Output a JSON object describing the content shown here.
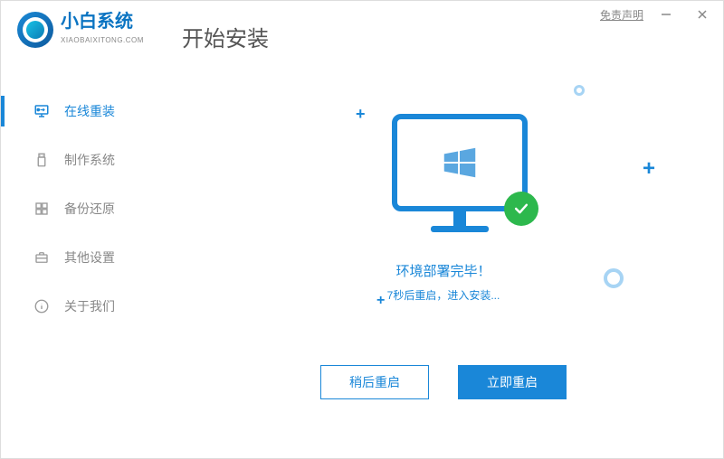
{
  "titlebar": {
    "disclaimer": "免责声明"
  },
  "logo": {
    "line1": "小白系统",
    "line2": "XIAOBAIXITONG.COM"
  },
  "page_title": "开始安装",
  "sidebar": {
    "items": [
      {
        "label": "在线重装",
        "icon": "monitor",
        "active": true
      },
      {
        "label": "制作系统",
        "icon": "usb",
        "active": false
      },
      {
        "label": "备份还原",
        "icon": "grid",
        "active": false
      },
      {
        "label": "其他设置",
        "icon": "briefcase",
        "active": false
      },
      {
        "label": "关于我们",
        "icon": "info",
        "active": false
      }
    ]
  },
  "status": {
    "main": "环境部署完毕！",
    "sub": "7秒后重启，进入安装...",
    "countdown_seconds": 7
  },
  "buttons": {
    "later": "稍后重启",
    "now": "立即重启"
  }
}
